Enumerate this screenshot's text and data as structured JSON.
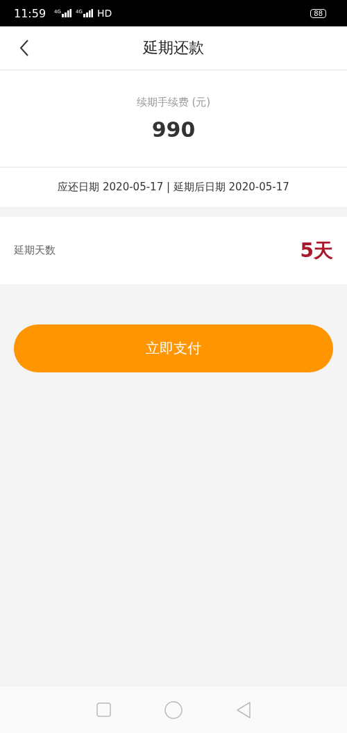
{
  "status_bar": {
    "time": "11:59",
    "networks": [
      "4G",
      "4G"
    ],
    "hd": "HD",
    "battery": "88"
  },
  "header": {
    "title": "延期还款"
  },
  "fee": {
    "label": "续期手续费 (元)",
    "amount": "990"
  },
  "dates": "应还日期 2020-05-17 | 延期后日期 2020-05-17",
  "extension": {
    "label": "延期天数",
    "value": "5天"
  },
  "pay_button": "立即支付"
}
